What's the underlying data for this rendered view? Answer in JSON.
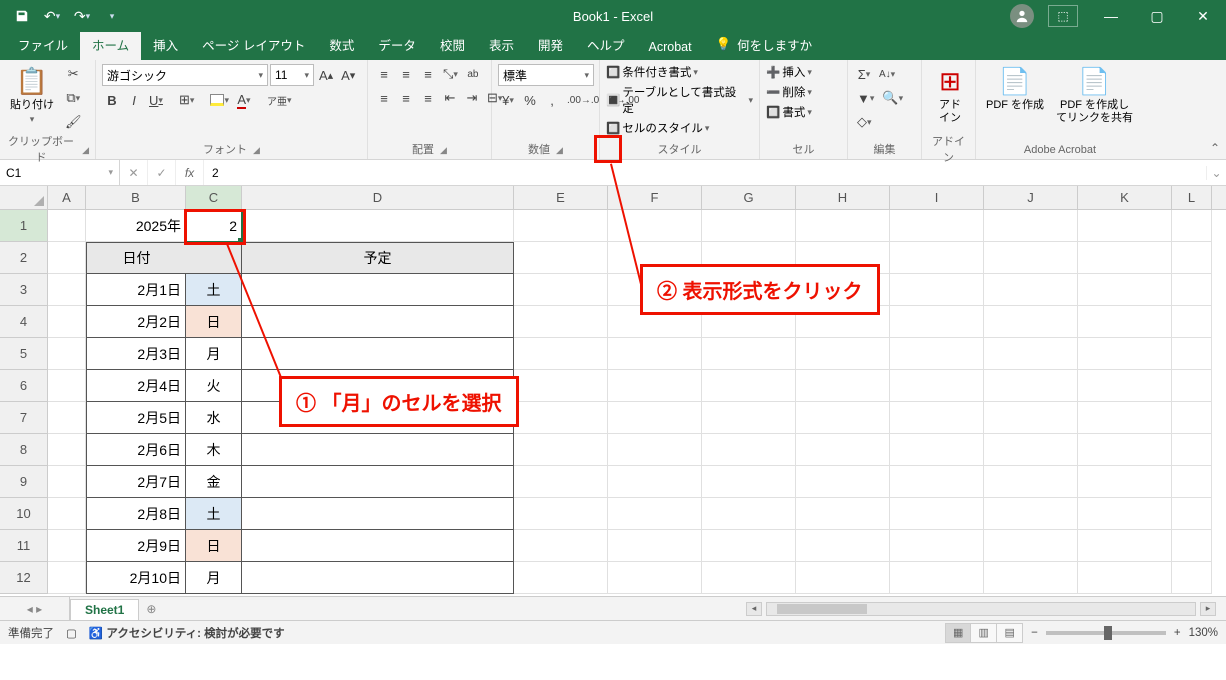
{
  "titlebar": {
    "title": "Book1 - Excel"
  },
  "tabs": {
    "file": "ファイル",
    "home": "ホーム",
    "insert": "挿入",
    "layout": "ページ レイアウト",
    "formulas": "数式",
    "data": "データ",
    "review": "校閲",
    "view": "表示",
    "developer": "開発",
    "help": "ヘルプ",
    "acrobat": "Acrobat",
    "tellme": "何をしますか"
  },
  "ribbon": {
    "clipboard": {
      "paste": "貼り付け",
      "label": "クリップボード"
    },
    "font": {
      "name": "游ゴシック",
      "size": "11",
      "label": "フォント",
      "bold": "B",
      "italic": "I",
      "underline": "U"
    },
    "alignment": {
      "label": "配置",
      "wrap": "ab"
    },
    "number": {
      "format": "標準",
      "label": "数値"
    },
    "styles": {
      "cond": "条件付き書式",
      "table": "テーブルとして書式設定",
      "cell": "セルのスタイル",
      "label": "スタイル"
    },
    "cells": {
      "insert": "挿入",
      "delete": "削除",
      "format": "書式",
      "label": "セル"
    },
    "editing": {
      "label": "編集"
    },
    "addin": {
      "label1": "アド",
      "label2": "イン",
      "group": "アドイン"
    },
    "acrobat": {
      "create": "PDF を作成",
      "share1": "PDF を作成し",
      "share2": "てリンクを共有",
      "group": "Adobe Acrobat"
    }
  },
  "formula_bar": {
    "name_box": "C1",
    "fx": "fx",
    "formula": "2"
  },
  "columns": [
    "A",
    "B",
    "C",
    "D",
    "E",
    "F",
    "G",
    "H",
    "I",
    "J",
    "K",
    "L"
  ],
  "row_nums": [
    "1",
    "2",
    "3",
    "4",
    "5",
    "6",
    "7",
    "8",
    "9",
    "10",
    "11",
    "12"
  ],
  "sheet": {
    "year": "2025年",
    "month": "2",
    "hdr_date": "日付",
    "hdr_plan": "予定",
    "rows": [
      {
        "date": "2月1日",
        "dow": "土",
        "cls": "sat"
      },
      {
        "date": "2月2日",
        "dow": "日",
        "cls": "sun"
      },
      {
        "date": "2月3日",
        "dow": "月",
        "cls": ""
      },
      {
        "date": "2月4日",
        "dow": "火",
        "cls": ""
      },
      {
        "date": "2月5日",
        "dow": "水",
        "cls": ""
      },
      {
        "date": "2月6日",
        "dow": "木",
        "cls": ""
      },
      {
        "date": "2月7日",
        "dow": "金",
        "cls": ""
      },
      {
        "date": "2月8日",
        "dow": "土",
        "cls": "sat"
      },
      {
        "date": "2月9日",
        "dow": "日",
        "cls": "sun"
      },
      {
        "date": "2月10日",
        "dow": "月",
        "cls": ""
      }
    ]
  },
  "sheet_tabs": {
    "name": "Sheet1"
  },
  "status": {
    "ready": "準備完了",
    "access": "アクセシビリティ: 検討が必要です",
    "zoom": "130%"
  },
  "callouts": {
    "c1": "① 「月」のセルを選択",
    "c2": "② 表示形式をクリック"
  }
}
